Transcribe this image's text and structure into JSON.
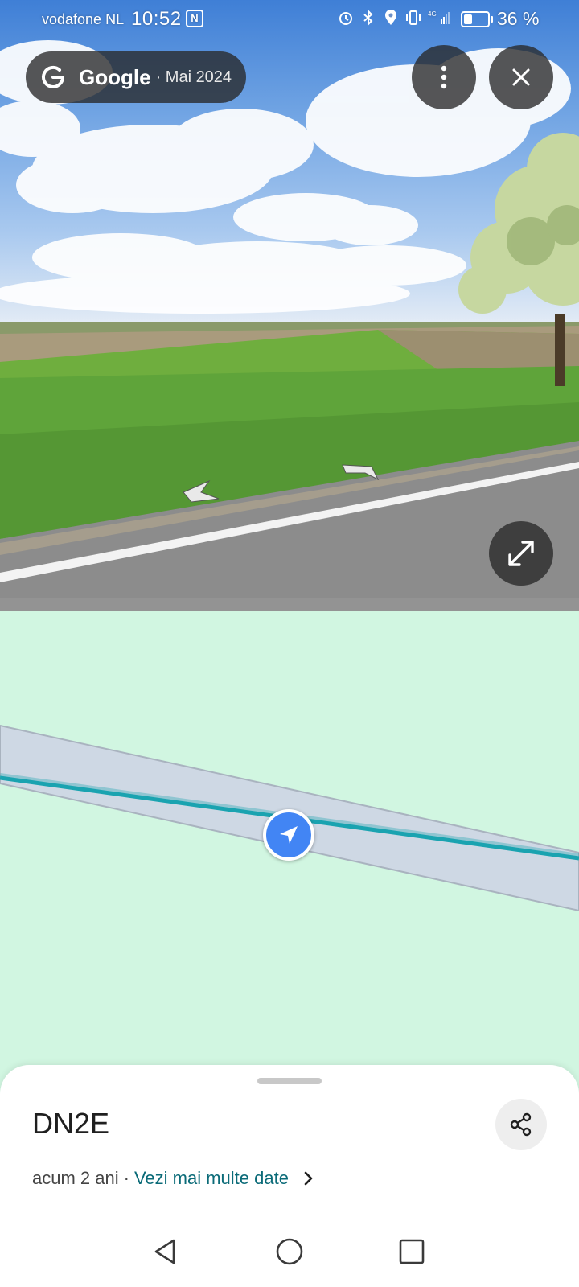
{
  "status_bar": {
    "carrier": "vodafone NL",
    "time": "10:52",
    "nfc": "N",
    "battery_percent": "36 %",
    "battery_level": 0.36,
    "icons": [
      "alarm-icon",
      "bluetooth-icon",
      "location-icon",
      "vibrate-icon",
      "signal-4g-icon"
    ]
  },
  "streetview": {
    "provider": "Google",
    "capture_date": "· Mai 2024",
    "more_icon": "more-vertical-icon",
    "close_icon": "close-icon",
    "expand_icon": "expand-icon"
  },
  "map": {
    "marker_icon": "navigation-arrow-icon",
    "route_color": "#1aa3b0",
    "road_color": "#cfd8e3",
    "background_color": "#d1f6e1"
  },
  "place": {
    "title": "DN2E",
    "age": "acum 2 ani",
    "separator": "·",
    "more_dates_link": "Vezi mai multe date",
    "share_icon": "share-icon"
  },
  "nav_bar": {
    "back_icon": "back-triangle-icon",
    "home_icon": "home-circle-icon",
    "recents_icon": "recents-square-icon"
  }
}
